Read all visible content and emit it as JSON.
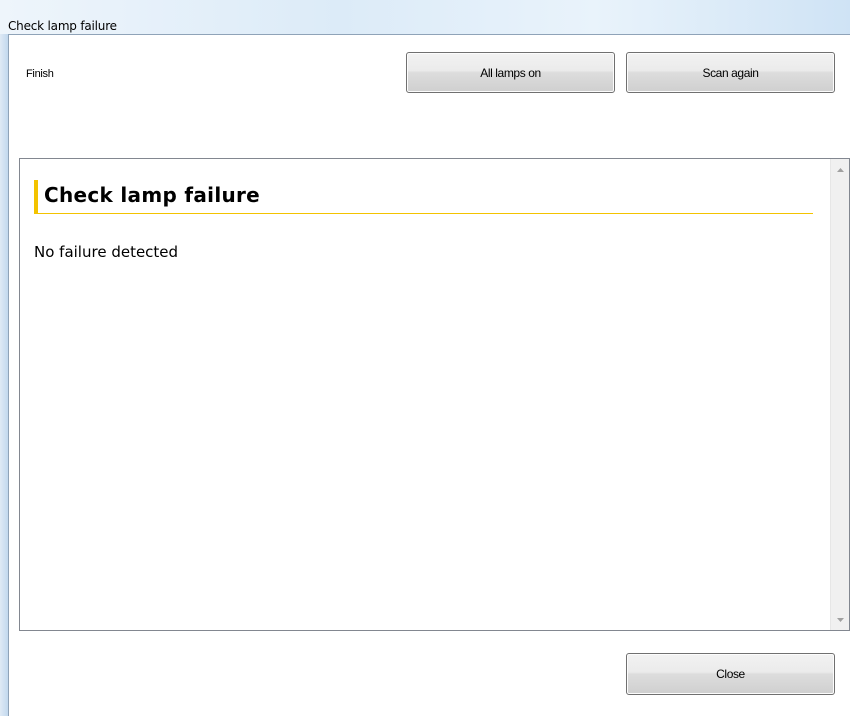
{
  "window": {
    "title": "Check lamp failure"
  },
  "top_panel": {
    "finish_label": "Finish",
    "all_lamps_on_label": "All lamps on",
    "scan_again_label": "Scan again"
  },
  "content": {
    "heading": "Check lamp failure",
    "message": "No failure detected"
  },
  "scrollbar": {
    "up_icon": "scroll-up-arrow",
    "down_icon": "scroll-down-arrow"
  },
  "footer": {
    "close_label": "Close"
  },
  "colors": {
    "accent": "#f3c300",
    "titlebar": "#dcebf8"
  }
}
